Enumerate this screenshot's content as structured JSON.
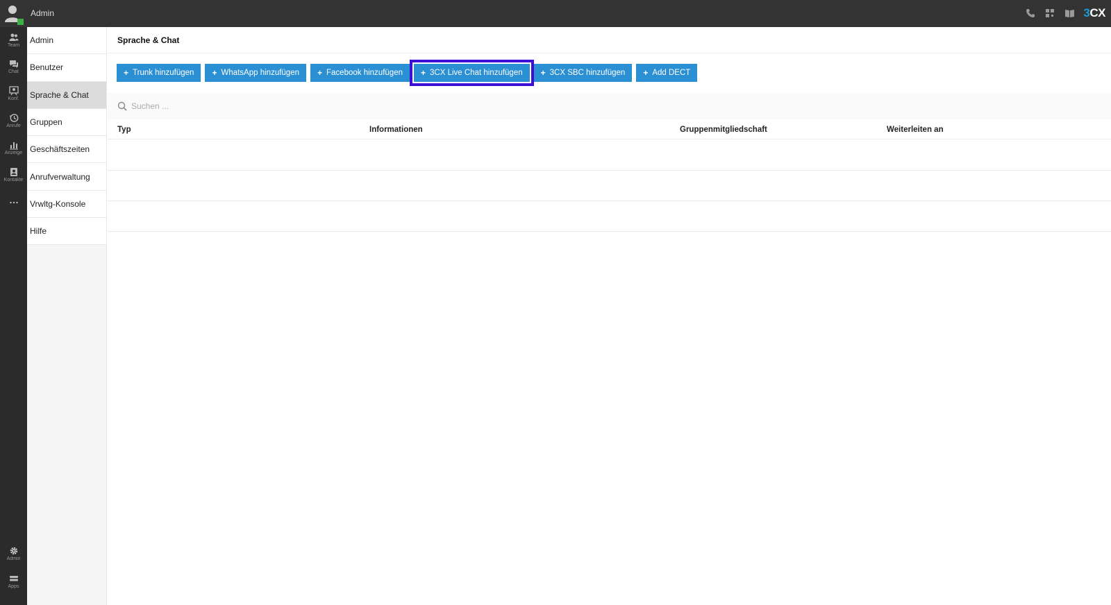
{
  "header": {
    "user_name": "Admin",
    "brand": {
      "prefix": "3",
      "suffix": "CX"
    }
  },
  "rail": {
    "items": [
      {
        "label": "Team",
        "icon": "team-icon"
      },
      {
        "label": "Chat",
        "icon": "chat-icon"
      },
      {
        "label": "Konf.",
        "icon": "conference-icon"
      },
      {
        "label": "Anrufe",
        "icon": "calls-history-icon"
      },
      {
        "label": "Anzeige",
        "icon": "reports-icon"
      },
      {
        "label": "Kontakte",
        "icon": "contacts-icon"
      },
      {
        "label": "",
        "icon": "more-icon"
      }
    ],
    "bottom": [
      {
        "label": "Admin",
        "icon": "gear-icon"
      },
      {
        "label": "Apps",
        "icon": "apps-icon"
      }
    ]
  },
  "subnav": {
    "items": [
      "Admin",
      "Benutzer",
      "Sprache & Chat",
      "Gruppen",
      "Geschäftszeiten",
      "Anrufverwaltung",
      "Vrwltg-Konsole",
      "Hilfe"
    ],
    "active": "Sprache & Chat"
  },
  "main": {
    "title": "Sprache & Chat",
    "toolbar": {
      "buttons": [
        "Trunk hinzufügen",
        "WhatsApp hinzufügen",
        "Facebook hinzufügen",
        "3CX Live Chat hinzufügen",
        "3CX SBC hinzufügen",
        "Add DECT"
      ],
      "highlighted": "3CX Live Chat hinzufügen",
      "plus": "+"
    },
    "search": {
      "placeholder": "Suchen ..."
    },
    "table": {
      "columns": [
        "Typ",
        "Informationen",
        "Gruppenmitgliedschaft",
        "Weiterleiten an"
      ],
      "rows": [
        [],
        [],
        []
      ]
    }
  },
  "colors": {
    "topbar": "#333333",
    "rail": "#2b2b2b",
    "button": "#2b8fd3",
    "highlight": "#3b0fd6",
    "status": "#3cb043"
  }
}
